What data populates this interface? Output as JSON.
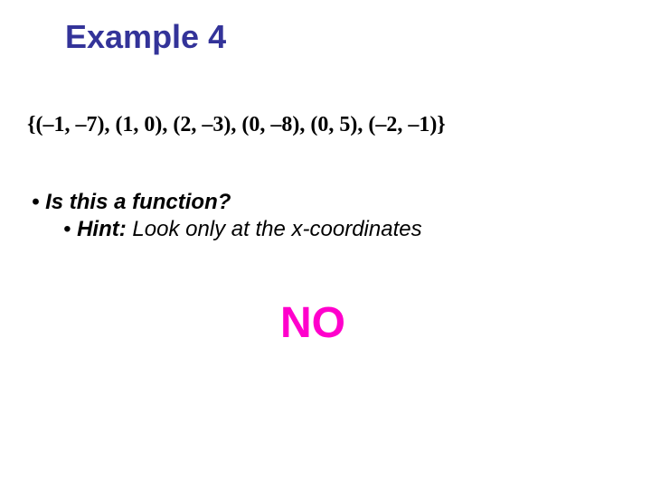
{
  "slide": {
    "title": "Example 4",
    "set_expression": "{(–1, –7), (1, 0), (2, –3), (0, –8), (0, 5), (–2, –1)}",
    "question": "Is this a function?",
    "hint_label": "Hint:",
    "hint_text": "  Look only at the x-coordinates",
    "answer": "NO"
  }
}
